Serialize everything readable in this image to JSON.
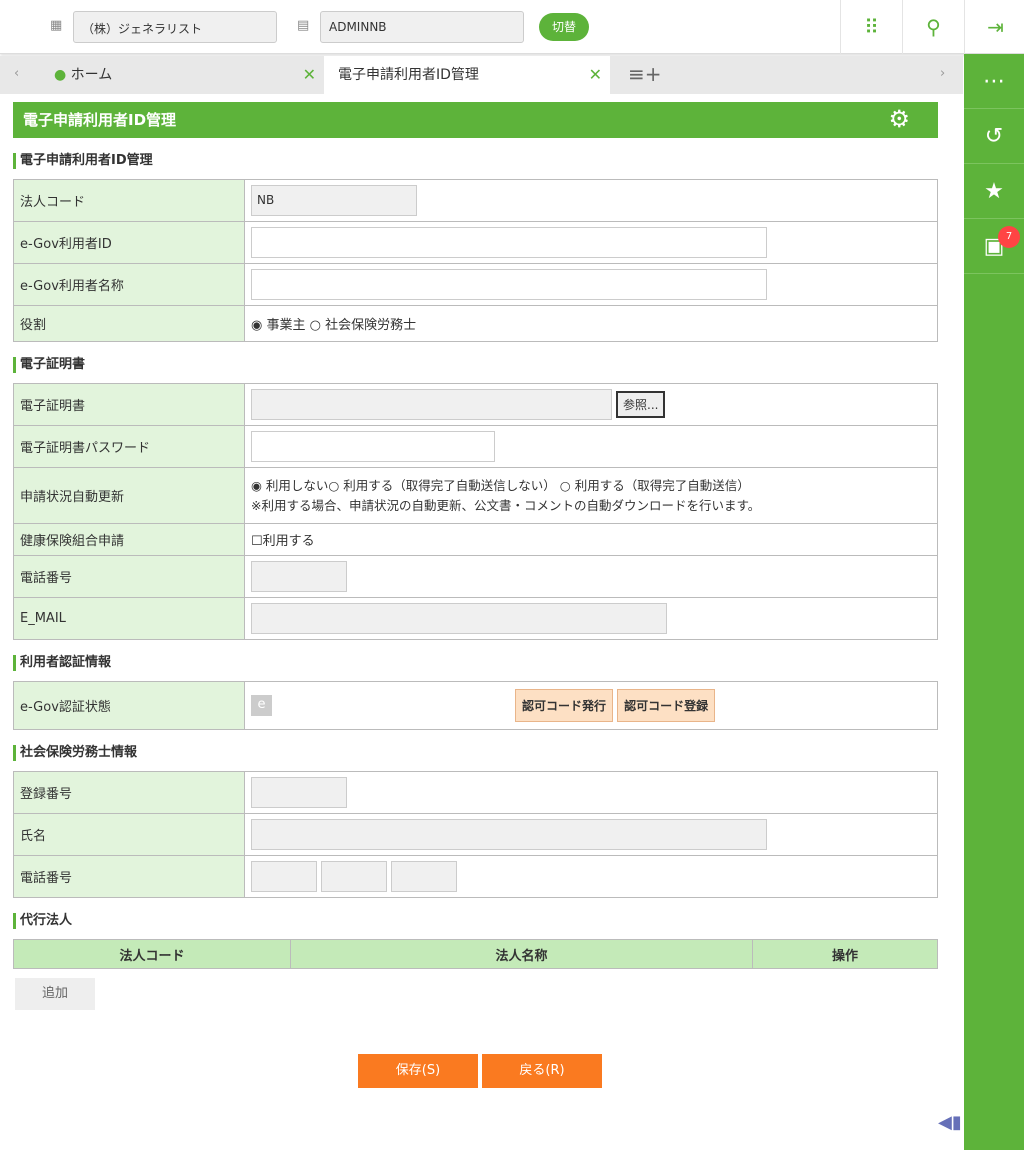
{
  "topbar": {
    "company": "（株）ジェネラリスト",
    "user": "ADMINNB",
    "switch_label": "切替"
  },
  "tabs": [
    {
      "label": "ホーム"
    },
    {
      "label": "電子申請利用者ID管理"
    }
  ],
  "sidebar": {
    "badge": "7"
  },
  "page_title": "電子申請利用者ID管理",
  "sections": {
    "s1": {
      "title": "電子申請利用者ID管理",
      "corp_code_label": "法人コード",
      "corp_code": "NB",
      "egov_id_label": "e-Gov利用者ID",
      "egov_name_label": "e-Gov利用者名称",
      "role_label": "役割",
      "role_opt1": "事業主",
      "role_opt2": "社会保険労務士"
    },
    "s2": {
      "title": "電子証明書",
      "cert_label": "電子証明書",
      "browse": "参照...",
      "cert_pw_label": "電子証明書パスワード",
      "auto_label": "申請状況自動更新",
      "auto_opt1": "利用しない",
      "auto_opt2": "利用する（取得完了自動送信しない）",
      "auto_opt3": "利用する（取得完了自動送信）",
      "auto_note": "※利用する場合、申請状況の自動更新、公文書・コメントの自動ダウンロードを行います。",
      "kenpo_label": "健康保険組合申請",
      "kenpo_check": "利用する",
      "tel_label": "電話番号",
      "email_label": "E_MAIL"
    },
    "s3": {
      "title": "利用者認証情報",
      "status_label": "e-Gov認証状態",
      "status_icon": "e",
      "issue_btn": "認可コード発行",
      "register_btn": "認可コード登録"
    },
    "s4": {
      "title": "社会保険労務士情報",
      "reg_label": "登録番号",
      "name_label": "氏名",
      "tel_label": "電話番号"
    },
    "s5": {
      "title": "代行法人",
      "col1": "法人コード",
      "col2": "法人名称",
      "col3": "操作",
      "add": "追加"
    }
  },
  "footer": {
    "save": "保存(S)",
    "back": "戻る(R)"
  }
}
